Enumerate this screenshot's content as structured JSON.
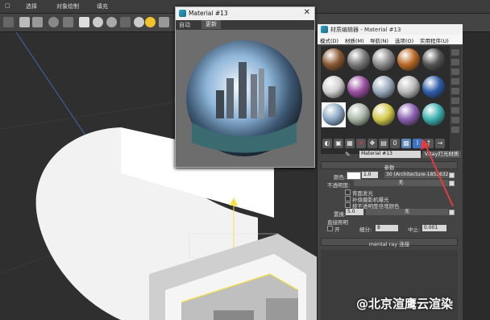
{
  "menu": {
    "items": [
      "选择",
      "对象绘制",
      "填充"
    ]
  },
  "preview_window": {
    "title": "Material #13",
    "tabs": [
      "自动",
      "更新"
    ]
  },
  "editor": {
    "title": "材质编辑器 - Material #13",
    "menu": [
      "模式(D)",
      "材质(M)",
      "导航(N)",
      "选项(O)",
      "实用程序(U)"
    ],
    "material_name": "Material #13",
    "material_type": "VRay灯光材质",
    "params_title": "参数",
    "color_label": "颜色:",
    "color_value": "1.0",
    "color_map": "30 (Architecture-1853632...)",
    "opacity_label": "不透明度:",
    "opacity_map": "无",
    "emit_back": "背面发光",
    "comp_emit": "补偿摄影机曝光",
    "mult_color": "按不透明度倍增颜色",
    "displace_label": "置换:",
    "displace_value": "5.0",
    "displace_map": "无",
    "direct_label": "直接照明",
    "direct_on": "开",
    "subdiv_label": "细分:",
    "subdiv_value": "8",
    "cutoff_label": "中止:",
    "cutoff_value": "0.001",
    "mr_rollout": "mental ray 连接"
  },
  "slot_colors": [
    [
      "#8a5a32",
      "#7a7a7a",
      "#8d8d8d",
      "#b96a25",
      "#555555"
    ],
    [
      "#d0d0d0",
      "#9a4fa0",
      "#9aaabc",
      "#b9b9b9",
      "#2c5da8"
    ],
    [
      "#8aa6c3",
      "#a9b7a6",
      "#d1c84a",
      "#8a5fb0",
      "#3fb0b0"
    ]
  ],
  "watermark": "@北京渲鹰云渲染"
}
